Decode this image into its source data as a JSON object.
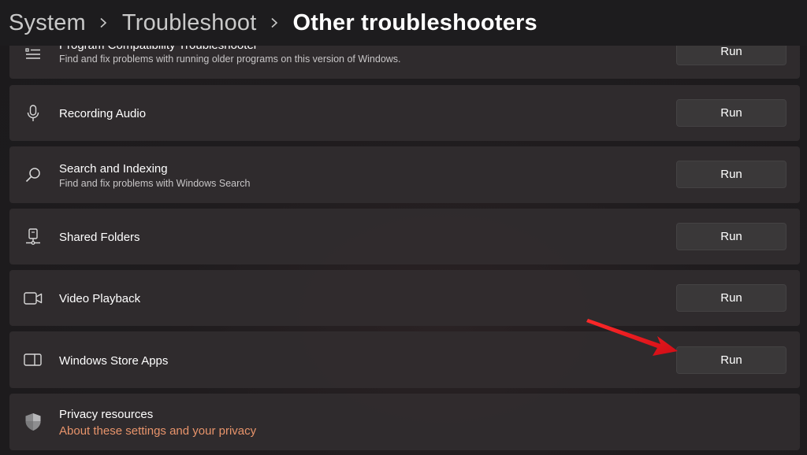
{
  "breadcrumb": {
    "items": [
      "System",
      "Troubleshoot"
    ],
    "current": "Other troubleshooters"
  },
  "troubleshooters": [
    {
      "title": "Program Compatibility Troubleshooter",
      "description": "Find and fix problems with running older programs on this version of Windows.",
      "icon": "list-icon",
      "button": "Run"
    },
    {
      "title": "Recording Audio",
      "description": "",
      "icon": "microphone-icon",
      "button": "Run"
    },
    {
      "title": "Search and Indexing",
      "description": "Find and fix problems with Windows Search",
      "icon": "search-icon",
      "button": "Run"
    },
    {
      "title": "Shared Folders",
      "description": "",
      "icon": "shared-folder-icon",
      "button": "Run"
    },
    {
      "title": "Video Playback",
      "description": "",
      "icon": "video-camera-icon",
      "button": "Run"
    },
    {
      "title": "Windows Store Apps",
      "description": "",
      "icon": "store-apps-icon",
      "button": "Run"
    }
  ],
  "privacy": {
    "title": "Privacy resources",
    "link": "About these settings and your privacy",
    "icon": "shield-icon"
  },
  "colors": {
    "link": "#e8946b",
    "annotation_arrow": "#e8121b"
  }
}
